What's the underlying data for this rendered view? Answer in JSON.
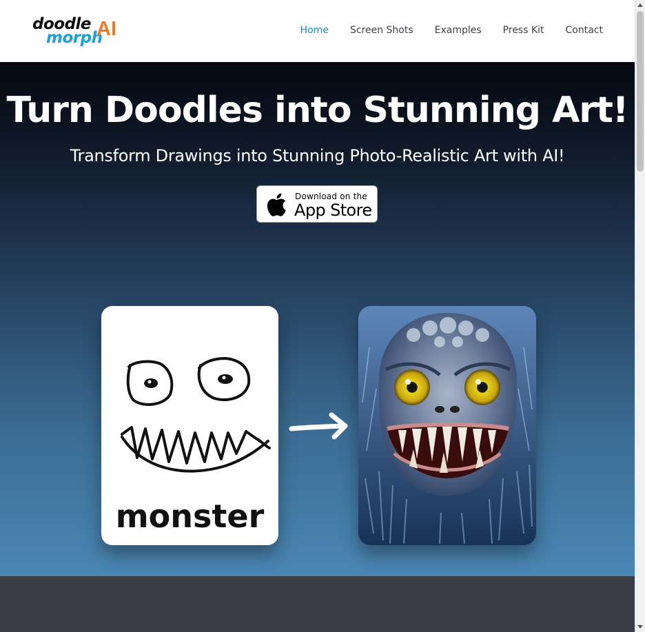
{
  "logo": {
    "line1": "doodle",
    "line2": "morph",
    "accent": "AI"
  },
  "nav": {
    "items": [
      {
        "label": "Home",
        "active": true
      },
      {
        "label": "Screen Shots",
        "active": false
      },
      {
        "label": "Examples",
        "active": false
      },
      {
        "label": "Press Kit",
        "active": false
      },
      {
        "label": "Contact",
        "active": false
      }
    ]
  },
  "hero": {
    "title": "Turn Doodles into Stunning Art!",
    "subtitle": "Transform Drawings into Stunning Photo-Realistic Art with AI!",
    "appstore": {
      "line1": "Download on the",
      "line2": "App Store"
    },
    "doodle_caption": "monster"
  },
  "colors": {
    "nav_active": "#1a8fb8",
    "nav_text": "#3b3f46",
    "logo_blue": "#1aa0dc",
    "logo_orange": "#f07a22",
    "footer_band": "#3a3d45"
  },
  "icons": [
    "apple-logo-icon",
    "right-arrow-icon"
  ]
}
